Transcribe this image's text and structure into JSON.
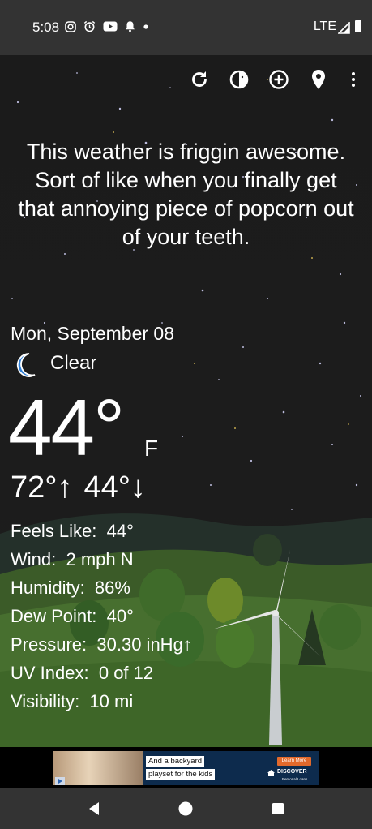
{
  "status_bar": {
    "time": "5:08",
    "network": "LTE",
    "icons": [
      "instagram-icon",
      "alarm-icon",
      "youtube-icon",
      "notification-bell-icon",
      "dot-icon"
    ]
  },
  "toolbar": {
    "icons": [
      "refresh-icon",
      "theme-icon",
      "add-location-icon",
      "location-pin-icon",
      "overflow-menu-icon"
    ]
  },
  "quote": "This weather is friggin awesome. Sort of like when you finally get that annoying piece of popcorn out of your teeth.",
  "date": "Mon, September 08",
  "condition": {
    "icon": "crescent-moon-icon",
    "label": "Clear"
  },
  "current_temp": "44°",
  "temp_unit": "F",
  "high": "72°↑",
  "low": "44°↓",
  "details": [
    {
      "label": "Feels Like:",
      "value": "44°"
    },
    {
      "label": "Wind:",
      "value": "2 mph N"
    },
    {
      "label": "Humidity:",
      "value": "86%"
    },
    {
      "label": "Dew Point:",
      "value": "40°"
    },
    {
      "label": "Pressure:",
      "value": "30.30 inHg↑"
    },
    {
      "label": "UV Index:",
      "value": "0 of 12"
    },
    {
      "label": "Visibility:",
      "value": "10 mi"
    }
  ],
  "ad": {
    "headline_1": "And a backyard",
    "headline_2": "playset for the kids",
    "cta": "Learn More",
    "brand": "DISCOVER",
    "subbrand": "Personal Loans"
  },
  "colors": {
    "status_bar": "#333333",
    "sky": "#1c1c1c",
    "grass": "#466c2e",
    "ad_bg": "#0d2b4d",
    "ad_cta": "#e2692b",
    "moon": "#2f7fd6"
  }
}
